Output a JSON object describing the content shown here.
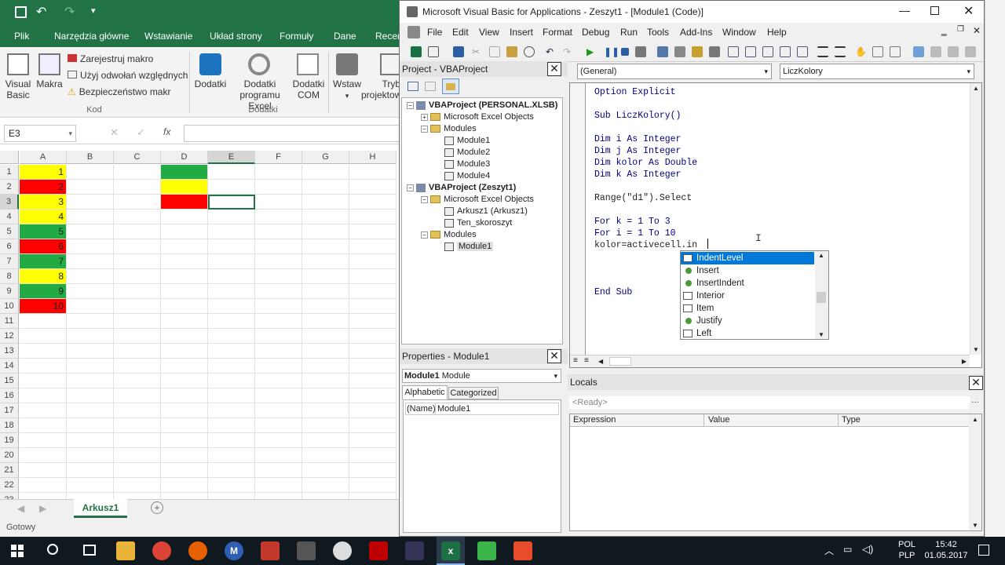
{
  "excel": {
    "tabs": [
      "Plik",
      "Narzędzia główne",
      "Wstawianie",
      "Układ strony",
      "Formuły",
      "Dane",
      "Recen"
    ],
    "ribbon": {
      "visual_basic": "Visual Basic",
      "makra": "Makra",
      "record_macro": "Zarejestruj makro",
      "relative_refs": "Użyj odwołań względnych",
      "macro_security": "Bezpieczeństwo makr",
      "kod_group": "Kod",
      "dodatki": "Dodatki",
      "dodatki_excel": "Dodatki programu Excel",
      "dodatki_com": "Dodatki COM",
      "dodatki_group": "Dodatki",
      "wstaw": "Wstaw",
      "tryb": "Tryb projektow"
    },
    "name_box": "E3",
    "fx": "fx",
    "columns": [
      "A",
      "B",
      "C",
      "D",
      "E",
      "F",
      "G",
      "H"
    ],
    "rows": [
      "1",
      "2",
      "3",
      "4",
      "5",
      "6",
      "7",
      "8",
      "9",
      "10",
      "11",
      "12",
      "13",
      "14",
      "15",
      "16",
      "17",
      "18",
      "19",
      "20",
      "21",
      "22",
      "23"
    ],
    "col_a_values": [
      "1",
      "2",
      "3",
      "4",
      "5",
      "6",
      "7",
      "8",
      "9",
      "10"
    ],
    "col_a_colors": [
      "#ffff00",
      "#ff0000",
      "#ffff00",
      "#ffff00",
      "#22aa44",
      "#ff0000",
      "#22aa44",
      "#ffff00",
      "#22aa44",
      "#ff0000"
    ],
    "col_d_colors": [
      "#22aa44",
      "#ffff00",
      "#ff0000"
    ],
    "sheet_tab": "Arkusz1",
    "status": "Gotowy"
  },
  "vba": {
    "title": "Microsoft Visual Basic for Applications - Zeszyt1 - [Module1 (Code)]",
    "menu": [
      "File",
      "Edit",
      "View",
      "Insert",
      "Format",
      "Debug",
      "Run",
      "Tools",
      "Add-Ins",
      "Window",
      "Help"
    ],
    "project_title": "Project - VBAProject",
    "tree": [
      {
        "label": "VBAProject (PERSONAL.XLSB)",
        "bold": true,
        "indent": 0
      },
      {
        "label": "Microsoft Excel Objects",
        "indent": 1
      },
      {
        "label": "Modules",
        "indent": 1
      },
      {
        "label": "Module1",
        "indent": 2
      },
      {
        "label": "Module2",
        "indent": 2
      },
      {
        "label": "Module3",
        "indent": 2
      },
      {
        "label": "Module4",
        "indent": 2
      },
      {
        "label": "VBAProject (Zeszyt1)",
        "bold": true,
        "indent": 0
      },
      {
        "label": "Microsoft Excel Objects",
        "indent": 1
      },
      {
        "label": "Arkusz1 (Arkusz1)",
        "indent": 2
      },
      {
        "label": "Ten_skoroszyt",
        "indent": 2
      },
      {
        "label": "Modules",
        "indent": 1
      },
      {
        "label": "Module1",
        "indent": 2
      }
    ],
    "properties_title": "Properties - Module1",
    "properties_object": "Module1",
    "properties_object_type": "Module",
    "tab_alphabetic": "Alphabetic",
    "tab_categorized": "Categorized",
    "prop_name_key": "(Name)",
    "prop_name_value": "Module1",
    "general_dropdown": "(General)",
    "proc_dropdown": "LiczKolory",
    "code_lines": [
      "Option Explicit",
      "",
      "Sub LiczKolory()",
      "",
      "Dim i As Integer",
      "Dim j As Integer",
      "Dim kolor As Double",
      "Dim k As Integer",
      "",
      "Range(\"d1\").Select",
      "",
      "For k = 1 To 3",
      "For i = 1 To 10",
      "kolor=activecell.in",
      "",
      "",
      "",
      "End Sub"
    ],
    "autocomplete": [
      "IndentLevel",
      "Insert",
      "InsertIndent",
      "Interior",
      "Item",
      "Justify",
      "Left"
    ],
    "locals_title": "Locals",
    "locals_status": "<Ready>",
    "locals_cols": [
      "Expression",
      "Value",
      "Type"
    ]
  },
  "taskbar": {
    "lang_top": "POL",
    "lang_bottom": "PLP",
    "time": "15:42",
    "date": "01.05.2017"
  }
}
